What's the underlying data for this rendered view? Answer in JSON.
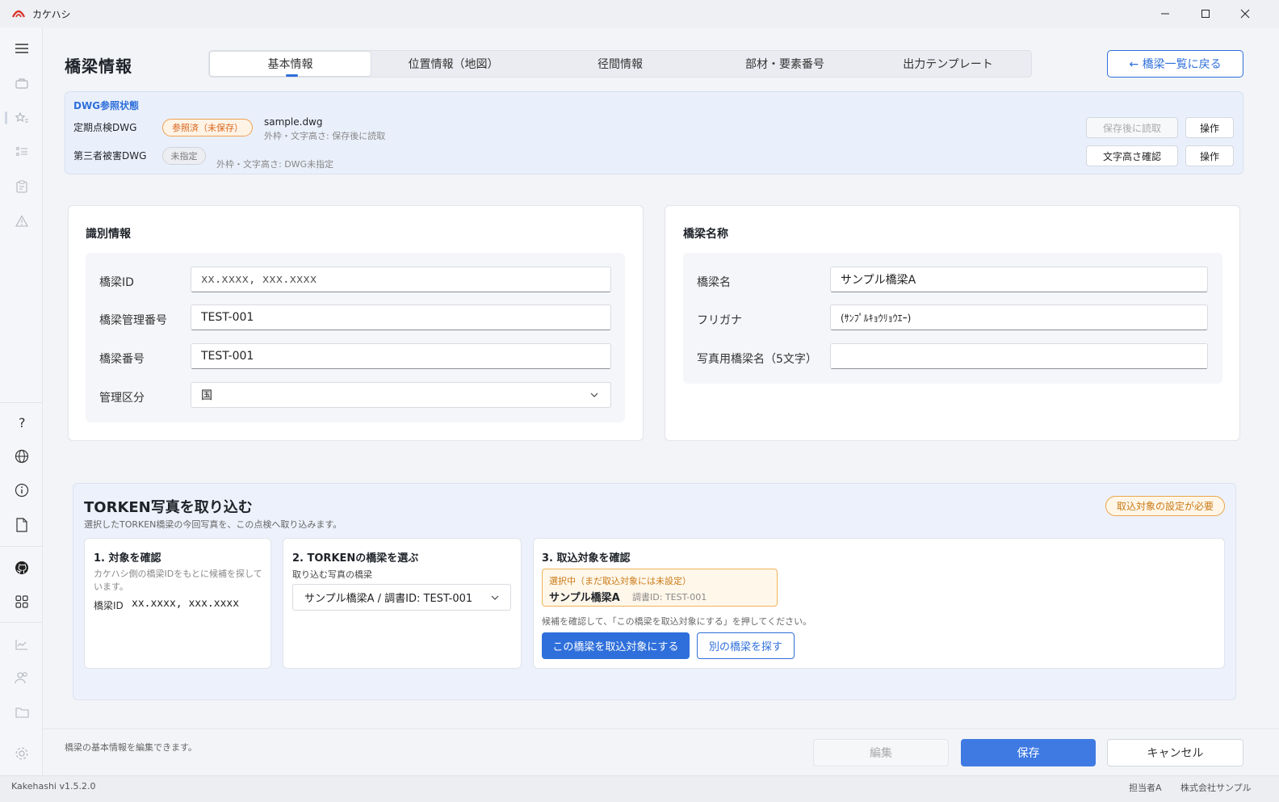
{
  "window": {
    "title": "カケハシ"
  },
  "page": {
    "title": "橋梁情報",
    "back_label": "← 橋梁一覧に戻る"
  },
  "tabs": [
    {
      "label": "基本情報",
      "active": true
    },
    {
      "label": "位置情報（地図）"
    },
    {
      "label": "径間情報"
    },
    {
      "label": "部材・要素番号"
    },
    {
      "label": "出力テンプレート"
    }
  ],
  "dwg": {
    "title": "DWG参照状態",
    "rows": [
      {
        "label": "定期点検DWG",
        "badge": "参照済（未保存）",
        "file": "sample.dwg",
        "note": "外枠・文字高さ: 保存後に読取",
        "action1": "保存後に読取",
        "action2": "操作"
      },
      {
        "label": "第三者被害DWG",
        "badge": "未指定",
        "note": "外枠・文字高さ: DWG未指定",
        "action1": "文字高さ確認",
        "action2": "操作"
      }
    ]
  },
  "identification": {
    "title": "識別情報",
    "fields": [
      {
        "label": "橋梁ID",
        "value": "xx.xxxx, xxx.xxxx"
      },
      {
        "label": "橋梁管理番号",
        "value": "TEST-001"
      },
      {
        "label": "橋梁番号",
        "value": "TEST-001"
      },
      {
        "label": "管理区分",
        "value": "国"
      }
    ]
  },
  "bridge_name": {
    "title": "橋梁名称",
    "fields": [
      {
        "label": "橋梁名",
        "value": "サンプル橋梁A"
      },
      {
        "label": "フリガナ",
        "value": "(ｻﾝﾌﾟﾙｷｮｳﾘｮｳｴｰ)"
      },
      {
        "label": "写真用橋梁名（5文字）",
        "value": ""
      }
    ]
  },
  "torken": {
    "title": "TORKEN写真を取り込む",
    "subtitle": "選択したTORKEN橋梁の今回写真を、この点検へ取り込みます。",
    "badge": "取込対象の設定が必要",
    "step1": {
      "title": "1. 対象を確認",
      "desc": "カケハシ側の橋梁IDをもとに候補を探しています。",
      "id_label": "橋梁ID",
      "id_value": "xx.xxxx, xxx.xxxx"
    },
    "step2": {
      "title": "2. TORKENの橋梁を選ぶ",
      "sublabel": "取り込む写真の橋梁",
      "select_value": "サンプル橋梁A / 調書ID: TEST-001"
    },
    "step3": {
      "title": "3. 取込対象を確認",
      "selected_label": "選択中（まだ取込対象には未設定）",
      "selected_name": "サンプル橋梁A",
      "selected_id": "調書ID: TEST-001",
      "hint": "候補を確認して、「この橋梁を取込対象にする」を押してください。",
      "primary_btn": "この橋梁を取込対象にする",
      "secondary_btn": "別の橋梁を探す"
    }
  },
  "footer": {
    "hint": "橋梁の基本情報を編集できます。",
    "edit": "編集",
    "save": "保存",
    "cancel": "キャンセル"
  },
  "status": {
    "version": "Kakehashi v1.5.2.0",
    "user": "担当者A",
    "company": "株式会社サンプル"
  },
  "colors": {
    "accent": "#2f6fdb",
    "warning": "#e8822a",
    "panel": "#eaf0fb"
  },
  "icons": [
    "menu-icon",
    "briefcase-icon",
    "star-list-icon",
    "list-icon",
    "clipboard-icon",
    "warning-icon",
    "help-icon",
    "globe-icon",
    "info-icon",
    "document-icon",
    "github-icon",
    "apps-icon",
    "chart-icon",
    "users-icon",
    "folder-icon",
    "settings-icon"
  ]
}
